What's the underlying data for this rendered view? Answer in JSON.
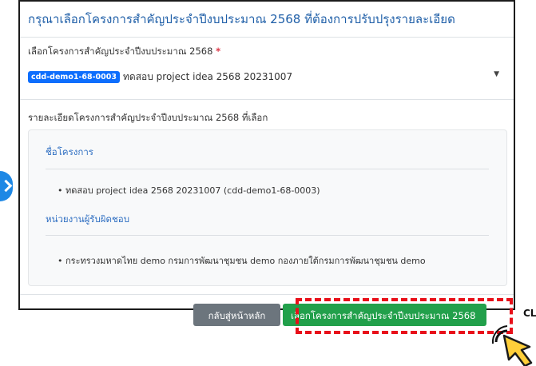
{
  "modal": {
    "title": "กรุณาเลือกโครงการสำคัญประจำปีงบประมาณ 2568 ที่ต้องการปรับปรุงรายละเอียด",
    "field_label": "เลือกโครงการสำคัญประจำปีงบประมาณ 2568",
    "required_mark": "*",
    "select": {
      "badge": "cdd-demo1-68-0003",
      "value": "ทดสอบ project idea 2568 20231007"
    },
    "detail_heading": "รายละเอียดโครงการสำคัญประจำปีงบประมาณ 2568 ที่เลือก",
    "sections": [
      {
        "title": "ชื่อโครงการ",
        "item": "ทดสอบ project idea 2568 20231007 (cdd-demo1-68-0003)"
      },
      {
        "title": "หน่วยงานผู้รับผิดชอบ",
        "item": "กระทรวงมหาดไทย demo กรมการพัฒนาชุมชน demo กองภายใต้กรมการพัฒนาชุมชน demo"
      }
    ],
    "buttons": {
      "back": "กลับสู่หน้าหลัก",
      "select": "เลือกโครงการสำคัญประจำปีงบประมาณ 2568"
    }
  },
  "annotation": {
    "click_label": "CLICK",
    "highlight_color": "#e8101a"
  },
  "colors": {
    "title": "#1f5fa8",
    "badge": "#0d6efd",
    "back_button": "#6c757d",
    "select_button": "#22a04b",
    "side_arrow": "#1e88e5"
  }
}
